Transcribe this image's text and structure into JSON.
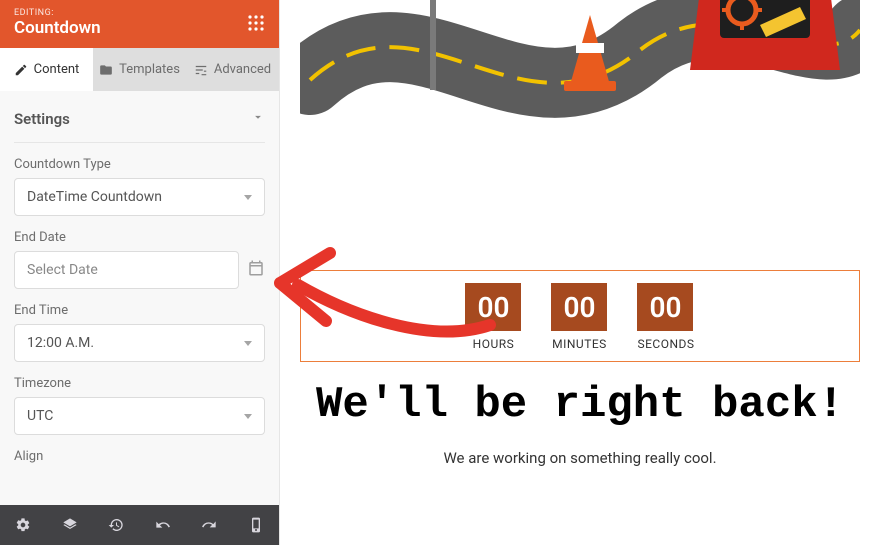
{
  "header": {
    "editing": "EDITING:",
    "title": "Countdown"
  },
  "tabs": {
    "content": "Content",
    "templates": "Templates",
    "advanced": "Advanced"
  },
  "section": {
    "settings": "Settings"
  },
  "fields": {
    "countdown_type": {
      "label": "Countdown Type",
      "value": "DateTime Countdown"
    },
    "end_date": {
      "label": "End Date",
      "placeholder": "Select Date"
    },
    "end_time": {
      "label": "End Time",
      "value": "12:00 A.M."
    },
    "timezone": {
      "label": "Timezone",
      "value": "UTC"
    },
    "align": {
      "label": "Align"
    }
  },
  "bottombar_icons": [
    "gear",
    "layers",
    "history",
    "undo",
    "redo",
    "mobile"
  ],
  "preview": {
    "countdown": {
      "hours": {
        "value": "00",
        "label": "HOURS"
      },
      "minutes": {
        "value": "00",
        "label": "MINUTES"
      },
      "seconds": {
        "value": "00",
        "label": "SECONDS"
      }
    },
    "heading": "We'll be right back!",
    "sub": "We are working on something really cool."
  },
  "colors": {
    "accent": "#E2562C",
    "tile": "#A64A1F",
    "border": "#EC7E3B",
    "anno_red": "#E6352A"
  }
}
